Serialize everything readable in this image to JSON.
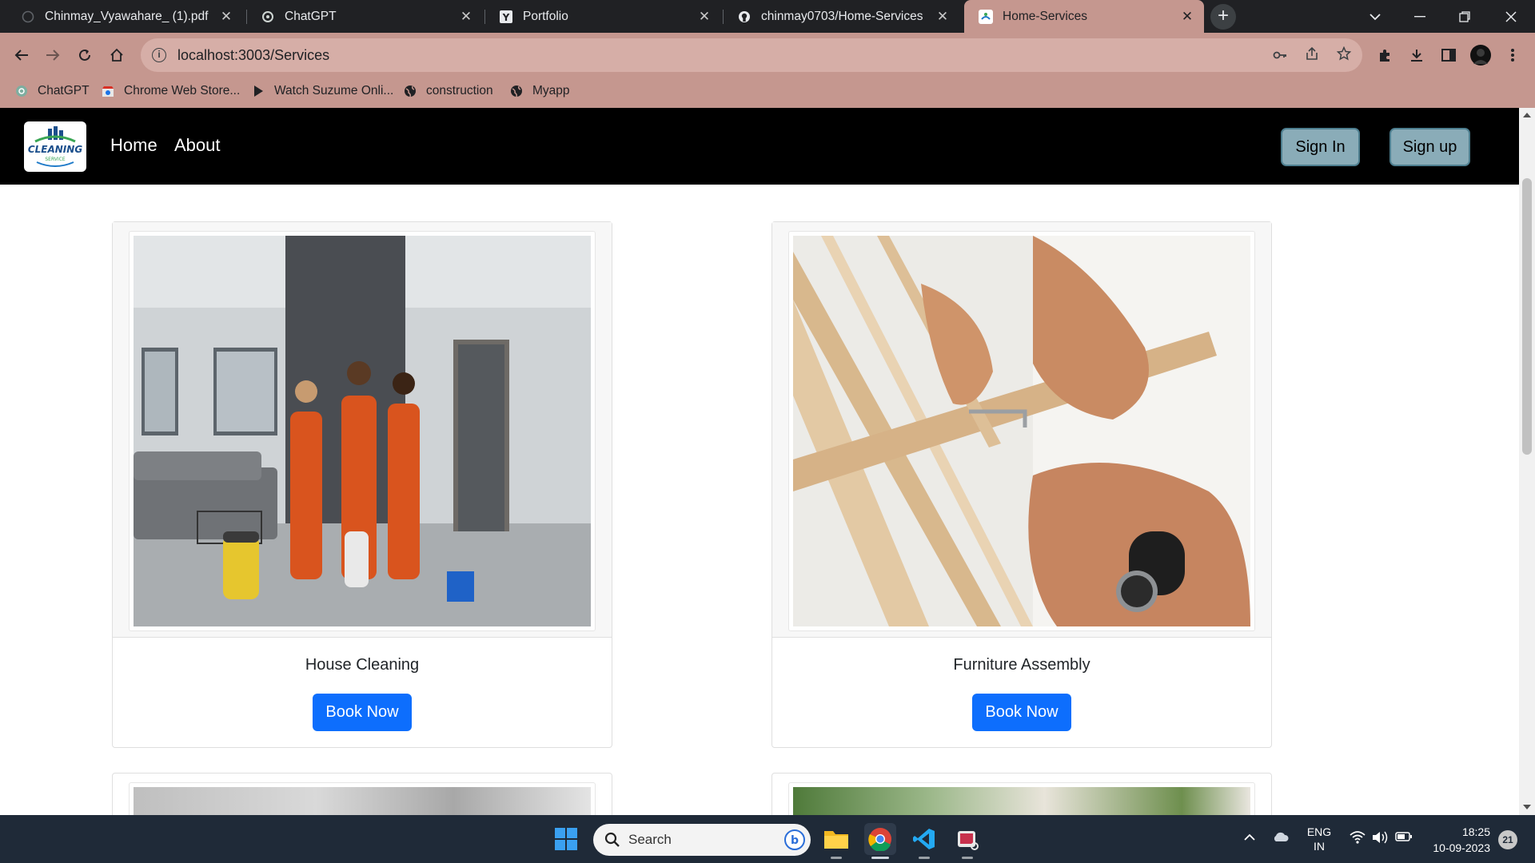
{
  "browser": {
    "tabs": [
      {
        "title": "Chinmay_Vyawahare_ (1).pdf",
        "icon": "pdf-icon",
        "active": false
      },
      {
        "title": "ChatGPT",
        "icon": "chatgpt-icon",
        "active": false
      },
      {
        "title": "Portfolio",
        "icon": "y-icon",
        "active": false
      },
      {
        "title": "chinmay0703/Home-Services",
        "icon": "github-icon",
        "active": false
      },
      {
        "title": "Home-Services",
        "icon": "cleaning-service-icon",
        "active": true
      }
    ],
    "new_tab_label": "+",
    "address": {
      "url": "localhost:3003/Services"
    },
    "bookmarks": [
      {
        "label": "ChatGPT",
        "icon": "chatgpt-icon"
      },
      {
        "label": "Chrome Web Store...",
        "icon": "chrome-web-store-icon"
      },
      {
        "label": "Watch Suzume Onli...",
        "icon": "play-icon"
      },
      {
        "label": "construction",
        "icon": "globe-icon"
      },
      {
        "label": "Myapp",
        "icon": "globe-icon"
      }
    ]
  },
  "site": {
    "logo_text": "CLEANING",
    "logo_sub": "SERVICE",
    "nav": {
      "home": "Home",
      "about": "About"
    },
    "auth": {
      "sign_in": "Sign In",
      "sign_up": "Sign up"
    },
    "services": [
      {
        "title": "House Cleaning",
        "button": "Book Now"
      },
      {
        "title": "Furniture Assembly",
        "button": "Book Now"
      }
    ]
  },
  "taskbar": {
    "search_placeholder": "Search",
    "language": "ENG",
    "region": "IN",
    "time": "18:25",
    "date": "10-09-2023",
    "notification_count": "21"
  },
  "colors": {
    "browser_accent": "#c5978f",
    "navbar": "#000000",
    "auth_button": "#8aacb8",
    "book_button": "#0d6efd",
    "taskbar": "#1f2a38"
  }
}
